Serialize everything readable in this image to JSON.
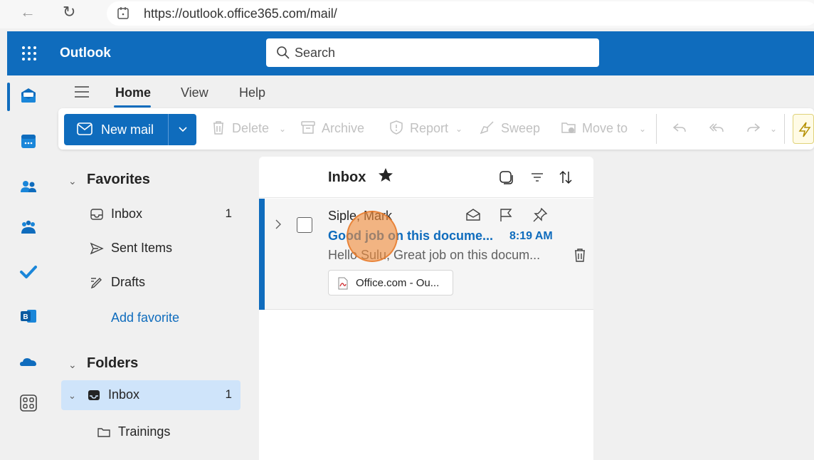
{
  "browser": {
    "url": "https://outlook.office365.com/mail/"
  },
  "app": {
    "title": "Outlook",
    "search_placeholder": "Search",
    "accent_color": "#0f6cbd"
  },
  "ribbon": {
    "tabs": [
      {
        "label": "Home",
        "active": true
      },
      {
        "label": "View",
        "active": false
      },
      {
        "label": "Help",
        "active": false
      }
    ],
    "new_mail_label": "New mail",
    "tools": [
      {
        "label": "Delete",
        "icon": "trash-icon"
      },
      {
        "label": "Archive",
        "icon": "archive-icon"
      },
      {
        "label": "Report",
        "icon": "shield-icon"
      },
      {
        "label": "Sweep",
        "icon": "broom-icon"
      },
      {
        "label": "Move to",
        "icon": "folder-move-icon"
      }
    ]
  },
  "folders": {
    "favorites_label": "Favorites",
    "favorites": [
      {
        "label": "Inbox",
        "count": "1",
        "icon": "inbox-icon"
      },
      {
        "label": "Sent Items",
        "count": "",
        "icon": "send-icon"
      },
      {
        "label": "Drafts",
        "count": "",
        "icon": "pencil-icon"
      }
    ],
    "add_favorite_label": "Add favorite",
    "folders_label": "Folders",
    "folders": [
      {
        "label": "Inbox",
        "count": "1",
        "icon": "inbox-icon",
        "selected": true
      },
      {
        "label": "Trainings",
        "count": "",
        "icon": "folder-icon",
        "selected": false
      }
    ]
  },
  "message_list": {
    "title": "Inbox",
    "messages": [
      {
        "sender": "Siple, Mark",
        "subject": "Good job on this docume...",
        "time": "8:19 AM",
        "preview": "Hello Sulu, Great job on this docum...",
        "attachment": "Office.com - Ou...",
        "unread": true
      }
    ]
  }
}
